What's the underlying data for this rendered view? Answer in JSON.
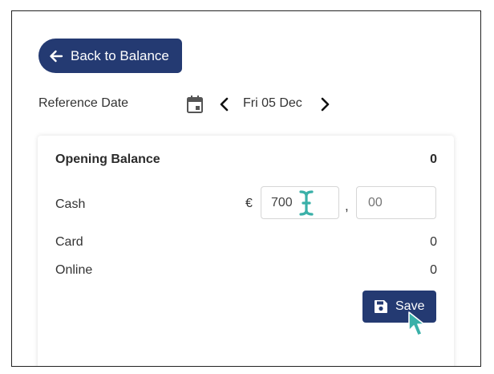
{
  "header": {
    "back_label": "Back to Balance"
  },
  "reference": {
    "label": "Reference Date",
    "date": "Fri 05 Dec"
  },
  "balance": {
    "opening_label": "Opening Balance",
    "opening_value": "0",
    "rows": [
      {
        "label": "Cash",
        "currency": "€",
        "amount": "700",
        "separator": ",",
        "decimals": "00"
      },
      {
        "label": "Card",
        "value": "0"
      },
      {
        "label": "Online",
        "value": "0"
      }
    ],
    "save_label": "Save"
  },
  "icons": {
    "back": "arrow-left-icon",
    "calendar": "calendar-icon",
    "prev": "chevron-left-icon",
    "next": "chevron-right-icon",
    "save": "floppy-disk-icon",
    "text_cursor": "text-cursor-icon",
    "pointer": "hand-pointer-icon"
  },
  "colors": {
    "primary": "#243a72",
    "cursor_accent": "#3ab0a8"
  }
}
